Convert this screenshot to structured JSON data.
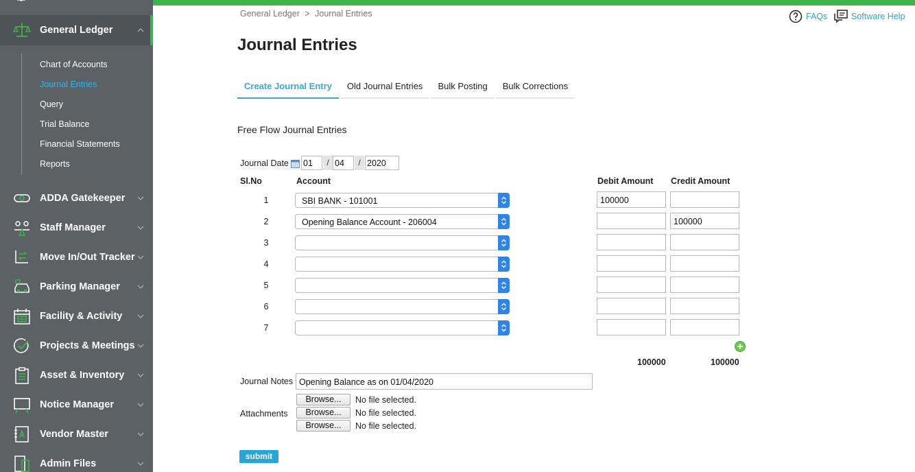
{
  "sidebar": {
    "sections": [
      {
        "label": "General Ledger",
        "icon": "scales-icon"
      },
      {
        "label": "ADDA Gatekeeper",
        "icon": "gatekeeper-icon"
      },
      {
        "label": "Staff Manager",
        "icon": "staff-icon"
      },
      {
        "label": "Move In/Out Tracker",
        "icon": "move-icon"
      },
      {
        "label": "Parking Manager",
        "icon": "car-icon"
      },
      {
        "label": "Facility & Activity",
        "icon": "calendar-icon"
      },
      {
        "label": "Projects & Meetings",
        "icon": "check-circle-icon"
      },
      {
        "label": "Asset & Inventory",
        "icon": "clipboard-icon"
      },
      {
        "label": "Notice Manager",
        "icon": "board-icon"
      },
      {
        "label": "Vendor Master",
        "icon": "vendor-book-icon"
      },
      {
        "label": "Admin Files",
        "icon": "files-icon"
      }
    ],
    "submenu": [
      "Chart of Accounts",
      "Journal Entries",
      "Query",
      "Trial Balance",
      "Financial Statements",
      "Reports"
    ],
    "active_sub": "Journal Entries"
  },
  "breadcrumb": {
    "root": "General Ledger",
    "sep": ">",
    "current": "Journal Entries"
  },
  "help": {
    "faqs": "FAQs",
    "software_help": "Software Help"
  },
  "page_title": "Journal Entries",
  "tabs": [
    "Create Journal Entry",
    "Old Journal Entries",
    "Bulk Posting",
    "Bulk Corrections"
  ],
  "active_tab": "Create Journal Entry",
  "section_title": "Free Flow Journal Entries",
  "journal_date": {
    "label": "Journal Date",
    "day": "01",
    "month": "04",
    "year": "2020",
    "sep": "/"
  },
  "columns": {
    "slno": "Sl.No",
    "account": "Account",
    "debit": "Debit Amount",
    "credit": "Credit Amount"
  },
  "rows": [
    {
      "no": "1",
      "account": "SBI BANK - 101001",
      "debit": "100000",
      "credit": ""
    },
    {
      "no": "2",
      "account": "Opening Balance Account - 206004",
      "debit": "",
      "credit": "100000"
    },
    {
      "no": "3",
      "account": "",
      "debit": "",
      "credit": ""
    },
    {
      "no": "4",
      "account": "",
      "debit": "",
      "credit": ""
    },
    {
      "no": "5",
      "account": "",
      "debit": "",
      "credit": ""
    },
    {
      "no": "6",
      "account": "",
      "debit": "",
      "credit": ""
    },
    {
      "no": "7",
      "account": "",
      "debit": "",
      "credit": ""
    }
  ],
  "totals": {
    "debit": "100000",
    "credit": "100000"
  },
  "notes": {
    "label": "Journal Notes",
    "value": "Opening Balance as on 01/04/2020"
  },
  "attachments": {
    "label": "Attachments",
    "browse": "Browse...",
    "status": "No file selected."
  },
  "submit": "submit",
  "colors": {
    "accent": "#35a9d7",
    "green": "#3cb44a",
    "sidebar": "#5b6165",
    "select_spin": "#2f84e6"
  }
}
